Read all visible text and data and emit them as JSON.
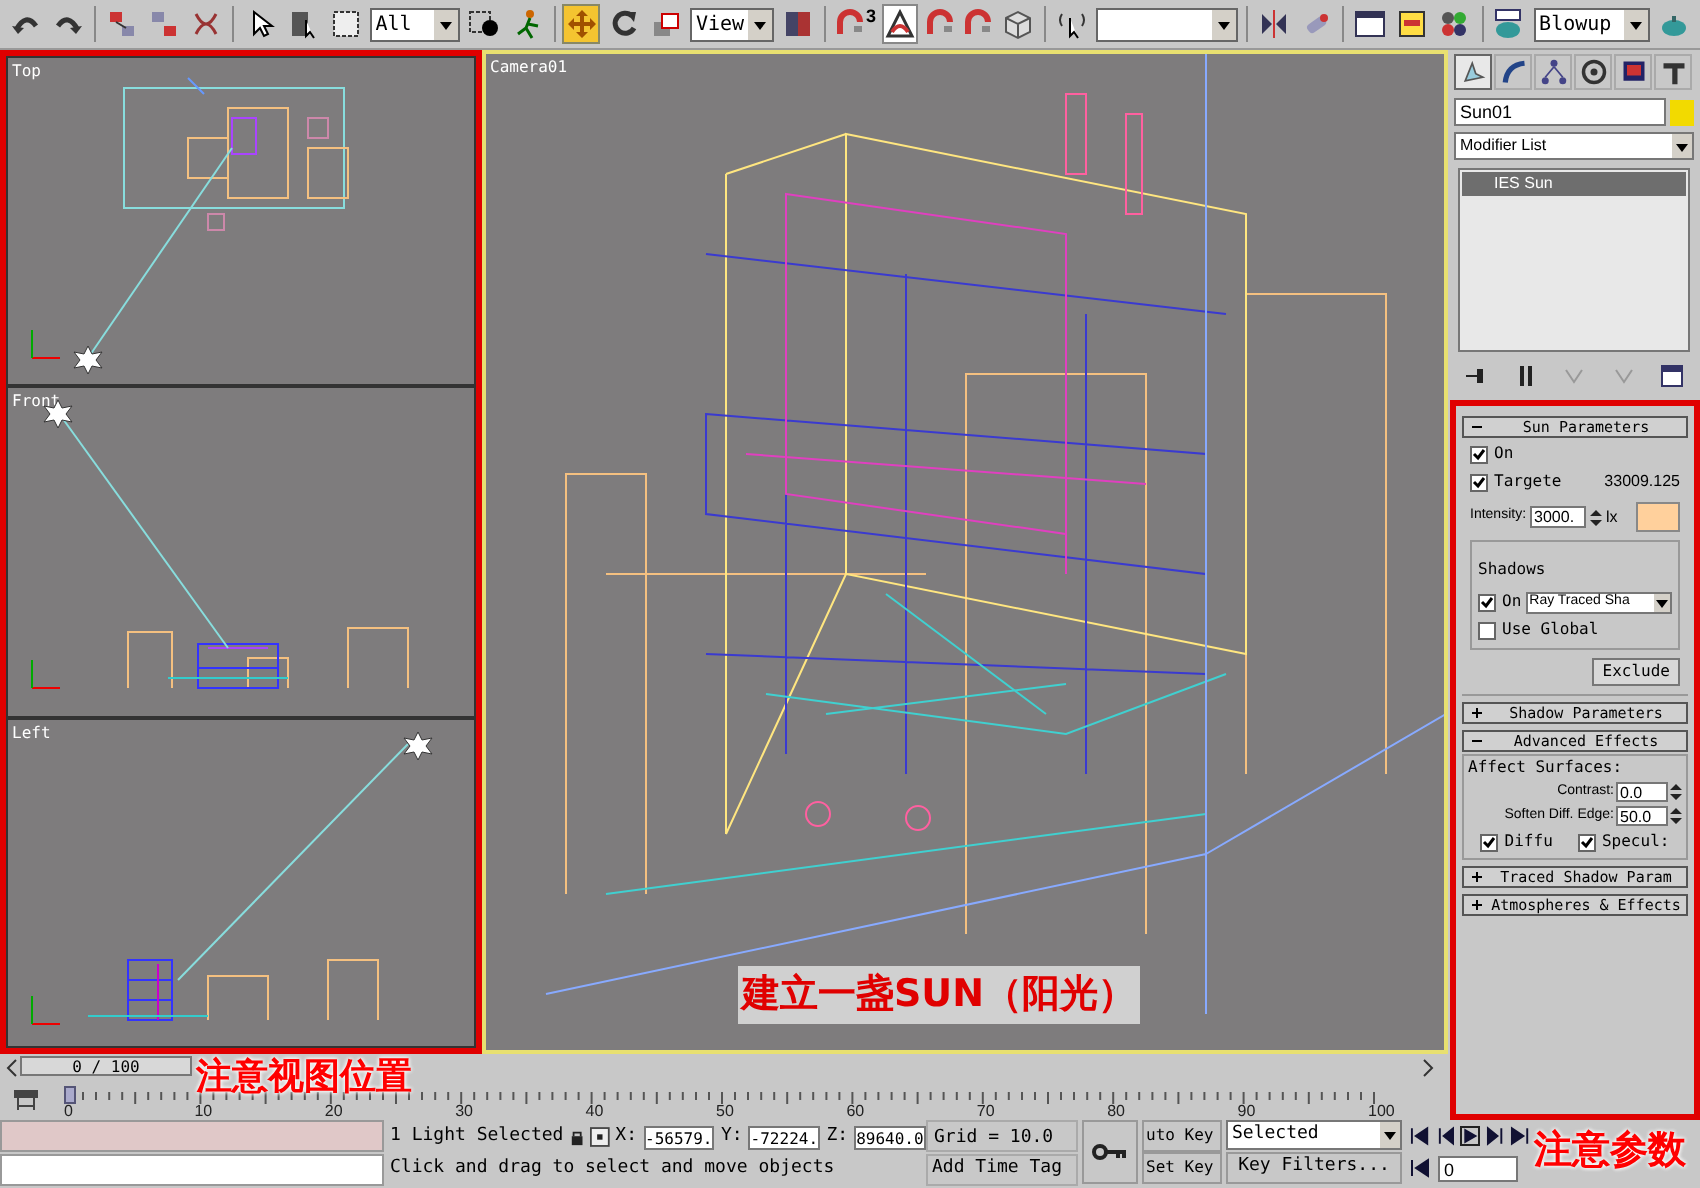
{
  "toolbar": {
    "selection_filter": "All",
    "reference_coordinate": "View",
    "render_type": "Blowup",
    "transform_tools": [
      {
        "selected": true
      },
      {
        "selected": false
      },
      {
        "selected": false
      }
    ],
    "snap_tools": [
      {
        "selected": false,
        "badge": "3"
      },
      {
        "selected": true
      },
      {
        "selected": false
      },
      {
        "selected": false
      }
    ]
  },
  "viewports": [
    {
      "label": "Top",
      "kind": "top",
      "active": false
    },
    {
      "label": "Front",
      "kind": "front",
      "active": false
    },
    {
      "label": "Left",
      "kind": "left",
      "active": false
    },
    {
      "label": "Camera01",
      "kind": "camera",
      "active": true
    }
  ],
  "command_panel": {
    "tabs": [
      {
        "selected": true
      },
      {
        "selected": false
      },
      {
        "selected": false
      },
      {
        "selected": false
      },
      {
        "selected": false
      },
      {
        "selected": false
      }
    ],
    "object_name": "Sun01",
    "modifier_list": "Modifier List",
    "stack": [
      {
        "label": "IES Sun",
        "selected": true
      }
    ],
    "sun_parameters": {
      "title": "Sun Parameters",
      "expanded": true,
      "on": {
        "label": "On",
        "checked": true
      },
      "targeted": {
        "label": "Targete",
        "checked": true
      },
      "target_distance": "33009.125",
      "intensity_label": "Intensity:",
      "intensity": "3000.",
      "unit": "lx",
      "shadows": {
        "title": "Shadows",
        "on": {
          "label": "On",
          "checked": true
        },
        "type": "Ray Traced Sha",
        "use_global": {
          "label": "Use Global",
          "checked": false
        }
      },
      "exclude_button": "Exclude"
    },
    "shadow_parameters": {
      "title": "Shadow Parameters",
      "expanded": false
    },
    "advanced_effects": {
      "title": "Advanced Effects",
      "expanded": true,
      "group_title": "Affect Surfaces:",
      "contrast_label": "Contrast:",
      "contrast": "0.0",
      "soften_label": "Soften Diff. Edge:",
      "soften": "50.0",
      "diffuse": {
        "label": "Diffu",
        "checked": true
      },
      "specular": {
        "label": "Specul:",
        "checked": true
      }
    },
    "more_rollouts": [
      {
        "title": "Traced Shadow Param",
        "expanded": false
      },
      {
        "title": "Atmospheres & Effects",
        "expanded": false
      }
    ]
  },
  "time_slider": {
    "label": "0 / 100",
    "level": 0
  },
  "ruler": {
    "labels": [
      "0",
      "10",
      "20",
      "30",
      "40",
      "50",
      "60",
      "70",
      "80",
      "90",
      "100"
    ]
  },
  "status": {
    "selection_count": "1 Light Selected",
    "prompt": "Click and drag to select and move objects",
    "coordinates": [
      {
        "axis": "X:",
        "value": "-56579."
      },
      {
        "axis": "Y:",
        "value": "-72224."
      },
      {
        "axis": "Z:",
        "value": "89640.0"
      }
    ],
    "grid": "Grid = 10.0",
    "add_time_tag": "Add Time Tag",
    "auto_key": "uto Key",
    "set_key": "Set Key",
    "key_mode": "Selected",
    "key_filters": "Key Filters...",
    "current_frame": "0"
  },
  "annotations": {
    "scene": "建立一盏SUN（阳光）",
    "viewports": "注意视图位置",
    "parameters": "注意参数"
  }
}
